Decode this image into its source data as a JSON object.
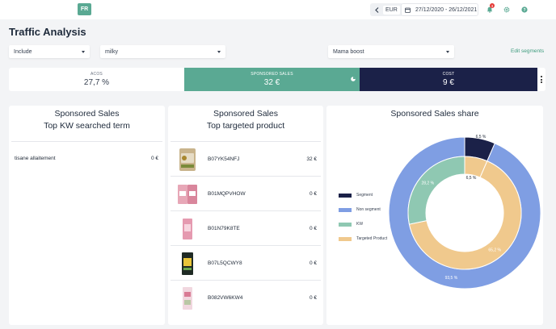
{
  "header": {
    "lang": "FR",
    "currency": "EUR",
    "date_range": "27/12/2020 - 26/12/2021",
    "notifications": "3"
  },
  "page": {
    "title": "Traffic Analysis"
  },
  "filters": {
    "mode": "Include",
    "keyword": "milky",
    "segment": "Mama boost",
    "edit_link": "Edit segments"
  },
  "kpis": [
    {
      "label": "ACOS",
      "value": "27,7 %"
    },
    {
      "label": "SPONSORED SALES",
      "value": "32 €"
    },
    {
      "label": "COST",
      "value": "9 €"
    }
  ],
  "kw_card": {
    "title1": "Sponsored Sales",
    "title2": "Top KW searched term",
    "rows": [
      {
        "term": "tisane allaitement",
        "value": "0 €"
      }
    ]
  },
  "product_card": {
    "title1": "Sponsored Sales",
    "title2": "Top targeted product",
    "rows": [
      {
        "id": "B07YK54NFJ",
        "value": "32 €"
      },
      {
        "id": "B01MQPVHOW",
        "value": "0 €"
      },
      {
        "id": "B01N79K8TE",
        "value": "0 €"
      },
      {
        "id": "B07L5QCWY8",
        "value": "0 €"
      },
      {
        "id": "B082VW6KW4",
        "value": "0 €"
      }
    ]
  },
  "share_card": {
    "title": "Sponsored Sales share"
  },
  "chart_data": {
    "type": "pie",
    "title": "Sponsored Sales share",
    "legend": [
      "Segment",
      "Non segment",
      "KW",
      "Targeted Product"
    ],
    "colors": {
      "Segment": "#1b2148",
      "Non segment": "#7f9ee3",
      "KW": "#8fc8b2",
      "Targeted Product": "#f0c98d"
    },
    "outer_ring": [
      {
        "name": "Segment",
        "value": 6.5,
        "label": "6,5 %"
      },
      {
        "name": "Non segment",
        "value": 93.5,
        "label": "93,5 %"
      }
    ],
    "inner_ring": [
      {
        "name": "Targeted Product",
        "value": 6.5,
        "label": "6,5 %"
      },
      {
        "name": "Targeted Product",
        "value": 65.2,
        "label": "65,2 %"
      },
      {
        "name": "KW",
        "value": 28.2,
        "label": "28,2 %"
      }
    ]
  }
}
